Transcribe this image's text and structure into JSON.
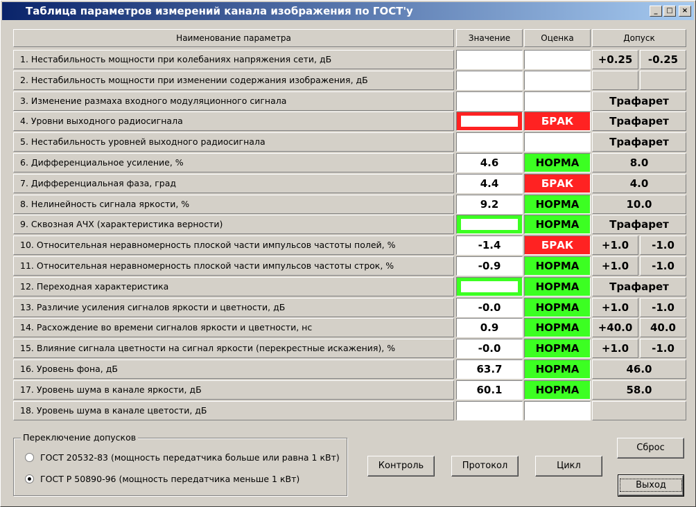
{
  "window": {
    "title": "Таблица параметров измерений канала изображения по ГОСТ'у",
    "controls": {
      "minimize": "_",
      "maximize": "□",
      "close": "×"
    }
  },
  "table": {
    "headers": {
      "name": "Наименование параметра",
      "value": "Значение",
      "estimate": "Оценка",
      "tolerance": "Допуск"
    },
    "rows": [
      {
        "name": "1. Нестабильность мощности при колебаниях напряжения сети, дБ",
        "value": "",
        "estimate": "",
        "tol_a": "+0.25",
        "tol_b": "-0.25"
      },
      {
        "name": "2. Нестабильность мощности при изменении содержания изображения, дБ",
        "value": "",
        "estimate": "",
        "tol_a": "",
        "tol_b": ""
      },
      {
        "name": "3. Изменение размаха входного модуляционного сигнала",
        "value": "",
        "estimate": "",
        "tol_full": "Трафарет"
      },
      {
        "name": "4. Уровни выходного радиосигнала",
        "value": "",
        "estimate": "БРАК",
        "tol_full": "Трафарет"
      },
      {
        "name": "5. Нестабильность уровней выходного радиосигнала",
        "value": "",
        "estimate": "",
        "tol_full": "Трафарет"
      },
      {
        "name": "6. Дифференциальное усиление, %",
        "value": "4.6",
        "estimate": "НОРМА",
        "tol_full": "8.0"
      },
      {
        "name": "7. Дифференциальная фаза, град",
        "value": "4.4",
        "estimate": "БРАК",
        "tol_full": "4.0"
      },
      {
        "name": "8. Нелинейность сигнала яркости, %",
        "value": "9.2",
        "estimate": "НОРМА",
        "tol_full": "10.0"
      },
      {
        "name": "9. Сквозная АЧХ (характеристика верности)",
        "value": "",
        "estimate": "НОРМА",
        "tol_full": "Трафарет"
      },
      {
        "name": "10. Относительная неравномерность плоской части импульсов частоты полей, %",
        "value": "-1.4",
        "estimate": "БРАК",
        "tol_a": "+1.0",
        "tol_b": "-1.0"
      },
      {
        "name": "11. Относительная неравномерность плоской части импульсов частоты строк, %",
        "value": "-0.9",
        "estimate": "НОРМА",
        "tol_a": "+1.0",
        "tol_b": "-1.0"
      },
      {
        "name": "12. Переходная характеристика",
        "value": "",
        "estimate": "НОРМА",
        "tol_full": "Трафарет"
      },
      {
        "name": "13. Различие усиления сигналов яркости и цветности, дБ",
        "value": "-0.0",
        "estimate": "НОРМА",
        "tol_a": "+1.0",
        "tol_b": "-1.0"
      },
      {
        "name": "14. Расхождение во времени сигналов яркости и цветности, нс",
        "value": "0.9",
        "estimate": "НОРМА",
        "tol_a": "+40.0",
        "tol_b": "40.0"
      },
      {
        "name": "15. Влияние сигнала цветности на сигнал яркости (перекрестные искажения), %",
        "value": "-0.0",
        "estimate": "НОРМА",
        "tol_a": "+1.0",
        "tol_b": "-1.0"
      },
      {
        "name": "16. Уровень фона, дБ",
        "value": "63.7",
        "estimate": "НОРМА",
        "tol_full": "46.0"
      },
      {
        "name": "17. Уровень шума в канале яркости, дБ",
        "value": "60.1",
        "estimate": "НОРМА",
        "tol_full": "58.0"
      },
      {
        "name": "18. Уровень шума в канале цветости, дБ",
        "value": "",
        "estimate": "",
        "tol_full": ""
      }
    ]
  },
  "tolerance_switch": {
    "legend": "Переключение допусков",
    "options": [
      "ГОСТ 20532-83 (мощность передатчика больше или равна 1 кВт)",
      "ГОСТ Р 50890-96 (мощность передатчика меньше 1 кВт)"
    ],
    "selected": 1
  },
  "buttons": {
    "control": "Контроль",
    "protocol": "Протокол",
    "cycle": "Цикл",
    "reset": "Сброс",
    "exit": "Выход"
  },
  "colors": {
    "norm": "#3cff22",
    "brak": "#ff2222",
    "title_bar": "#0a246a"
  }
}
